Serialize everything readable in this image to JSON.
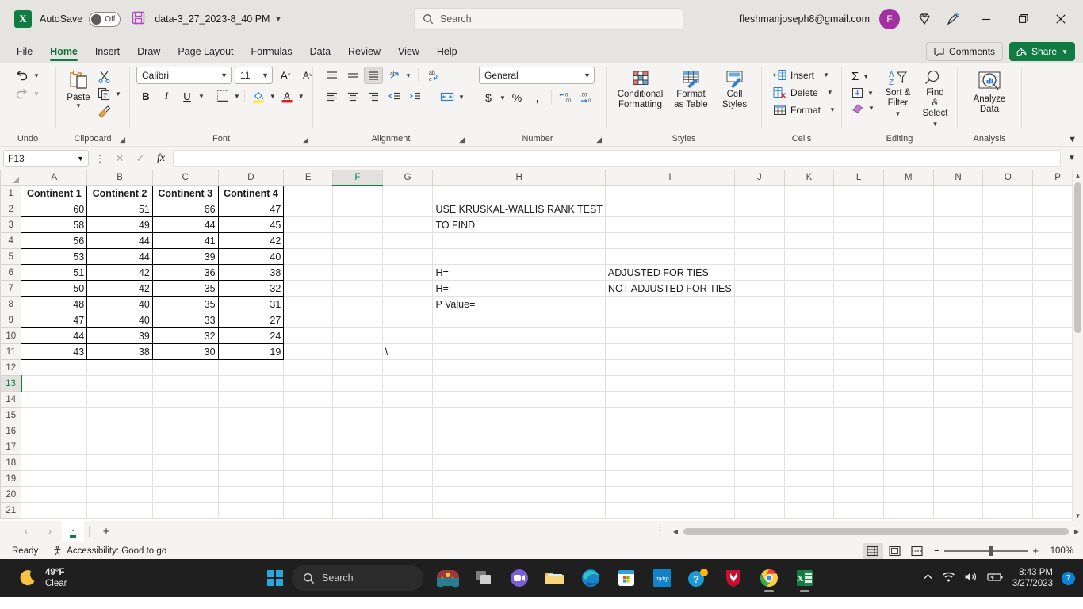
{
  "titlebar": {
    "app_icon": "excel-logo",
    "autosave_label": "AutoSave",
    "autosave_state": "Off",
    "document_name": "data-3_27_2023-8_40 PM",
    "search_placeholder": "Search",
    "account_email": "fleshmanjoseph8@gmail.com",
    "avatar_initial": "F",
    "minimize": "—",
    "restore": "❐",
    "close": "✕"
  },
  "tabs": [
    {
      "label": "File",
      "active": false
    },
    {
      "label": "Home",
      "active": true
    },
    {
      "label": "Insert",
      "active": false
    },
    {
      "label": "Draw",
      "active": false
    },
    {
      "label": "Page Layout",
      "active": false
    },
    {
      "label": "Formulas",
      "active": false
    },
    {
      "label": "Data",
      "active": false
    },
    {
      "label": "Review",
      "active": false
    },
    {
      "label": "View",
      "active": false
    },
    {
      "label": "Help",
      "active": false
    }
  ],
  "tabs_right": {
    "comments_label": "Comments",
    "share_label": "Share"
  },
  "ribbon": {
    "undo": {
      "group_label": "Undo",
      "undo_tip": "Undo",
      "redo_tip": "Redo"
    },
    "clipboard": {
      "group_label": "Clipboard",
      "paste_label": "Paste",
      "cut": "Cut",
      "copy": "Copy",
      "format_painter": "Format Painter"
    },
    "font": {
      "group_label": "Font",
      "font_name": "Calibri",
      "font_size": "11",
      "grow": "A",
      "shrink": "A",
      "bold": "B",
      "italic": "I",
      "underline": "U",
      "borders": "Borders",
      "fill_color": "Fill Color",
      "font_color": "Font Color"
    },
    "alignment": {
      "group_label": "Alignment",
      "wrap_text": "Wrap Text",
      "merge": "Merge & Center"
    },
    "number": {
      "group_label": "Number",
      "format": "General",
      "currency": "$",
      "percent": "%",
      "comma": "‚",
      "inc_dec": ".00",
      "dec_dec": ".00"
    },
    "styles": {
      "group_label": "Styles",
      "conditional_formatting": "Conditional Formatting",
      "format_as_table": "Format as Table",
      "cell_styles": "Cell Styles"
    },
    "cells": {
      "group_label": "Cells",
      "insert": "Insert",
      "delete": "Delete",
      "format": "Format"
    },
    "editing": {
      "group_label": "Editing",
      "autosum": "Σ",
      "fill": "Fill",
      "clear": "Clear",
      "sort_filter": "Sort & Filter",
      "find_select": "Find & Select"
    },
    "analysis": {
      "group_label": "Analysis",
      "analyze_data": "Analyze Data"
    }
  },
  "formula_bar": {
    "name_box": "F13",
    "cancel": "✕",
    "enter": "✓",
    "fx": "fx",
    "value": ""
  },
  "grid": {
    "columns": [
      "A",
      "B",
      "C",
      "D",
      "E",
      "F",
      "G",
      "H",
      "I",
      "J",
      "K",
      "L",
      "M",
      "N",
      "O",
      "P"
    ],
    "selected_column": "F",
    "selected_row": 13,
    "selected_cell": "F13",
    "rows": [
      1,
      2,
      3,
      4,
      5,
      6,
      7,
      8,
      9,
      10,
      11,
      12,
      13,
      14,
      15,
      16,
      17,
      18,
      19,
      20,
      21
    ],
    "headers": [
      "Continent 1",
      "Continent 2",
      "Continent 3",
      "Continent 4"
    ],
    "data": [
      [
        60,
        51,
        66,
        47
      ],
      [
        58,
        49,
        44,
        45
      ],
      [
        56,
        44,
        41,
        42
      ],
      [
        53,
        44,
        39,
        40
      ],
      [
        51,
        42,
        36,
        38
      ],
      [
        50,
        42,
        35,
        32
      ],
      [
        48,
        40,
        35,
        31
      ],
      [
        47,
        40,
        33,
        27
      ],
      [
        44,
        39,
        32,
        24
      ],
      [
        43,
        38,
        30,
        19
      ]
    ],
    "notes": {
      "h2": "USE KRUSKAL-WALLIS RANK TEST",
      "h3": "TO FIND",
      "h6": "H=",
      "h7": "H=",
      "h8": "P Value=",
      "i6": "ADJUSTED FOR TIES",
      "i7": "NOT ADJUSTED FOR TIES",
      "g11": "\\"
    }
  },
  "sheetbar": {
    "prev": "‹",
    "next": "›",
    "sheet_name": ".",
    "add_sheet": "+"
  },
  "statusbar": {
    "mode": "Ready",
    "accessibility": "Accessibility: Good to go",
    "view_normal": "normal-view-icon",
    "view_pagelayout": "page-layout-view-icon",
    "view_pagebreak": "page-break-view-icon",
    "zoom_out": "−",
    "zoom_in": "+",
    "zoom_level": "100%"
  },
  "taskbar": {
    "weather_temp": "49°F",
    "weather_cond": "Clear",
    "search_placeholder": "Search",
    "apps": [
      "widgets",
      "task-view",
      "teams",
      "file-explorer",
      "edge",
      "microsoft-store",
      "myhp",
      "help",
      "mcafee",
      "chrome",
      "excel"
    ],
    "time": "8:43 PM",
    "date": "3/27/2023",
    "notification_count": "7"
  },
  "colors": {
    "excel_green": "#107c41",
    "ribbon_bg": "#f5f4f2",
    "titlebar_bg": "#e6e4e1",
    "accent_purple": "#a330a3"
  }
}
